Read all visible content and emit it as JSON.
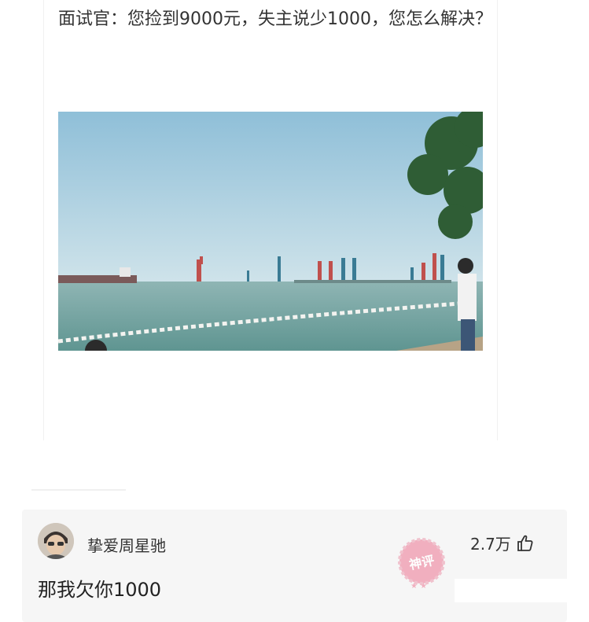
{
  "post": {
    "text": "面试官：您捡到9000元，失主说少1000，您怎么解决？"
  },
  "comment": {
    "username": "挚爱周星驰",
    "likes": "2.7万",
    "text": "那我欠你1000",
    "badge": "神评"
  },
  "icons": {
    "like": "thumbs-up-icon",
    "avatar": "avatar"
  }
}
